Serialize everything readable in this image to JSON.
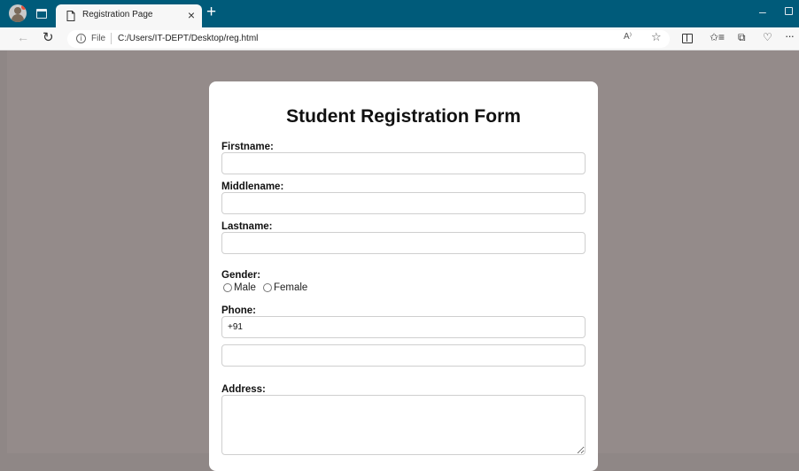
{
  "browser": {
    "tab": {
      "title": "Registration Page",
      "close_glyph": "×"
    },
    "newtab_glyph": "+",
    "minimize_glyph": "–",
    "address_bar": {
      "scheme_label": "File",
      "url": "C:/Users/IT-DEPT/Desktop/reg.html",
      "read_aloud_glyph": "A⁾"
    },
    "toolbar_icons": [
      "read-aloud-icon",
      "favorite-icon",
      "split-screen-icon",
      "favorites-bar-icon",
      "collections-icon",
      "performance-icon",
      "more-icon"
    ],
    "accent_color": "#005b7a"
  },
  "form": {
    "title": "Student Registration Form",
    "labels": {
      "firstname": "Firstname:",
      "middlename": "Middlename:",
      "lastname": "Lastname:",
      "gender": "Gender:",
      "phone": "Phone:",
      "address": "Address:"
    },
    "gender_options": [
      "Male",
      "Female"
    ],
    "phone_prefix_value": "+91",
    "values": {
      "firstname": "",
      "middlename": "",
      "lastname": "",
      "phone_number": "",
      "address": ""
    }
  }
}
